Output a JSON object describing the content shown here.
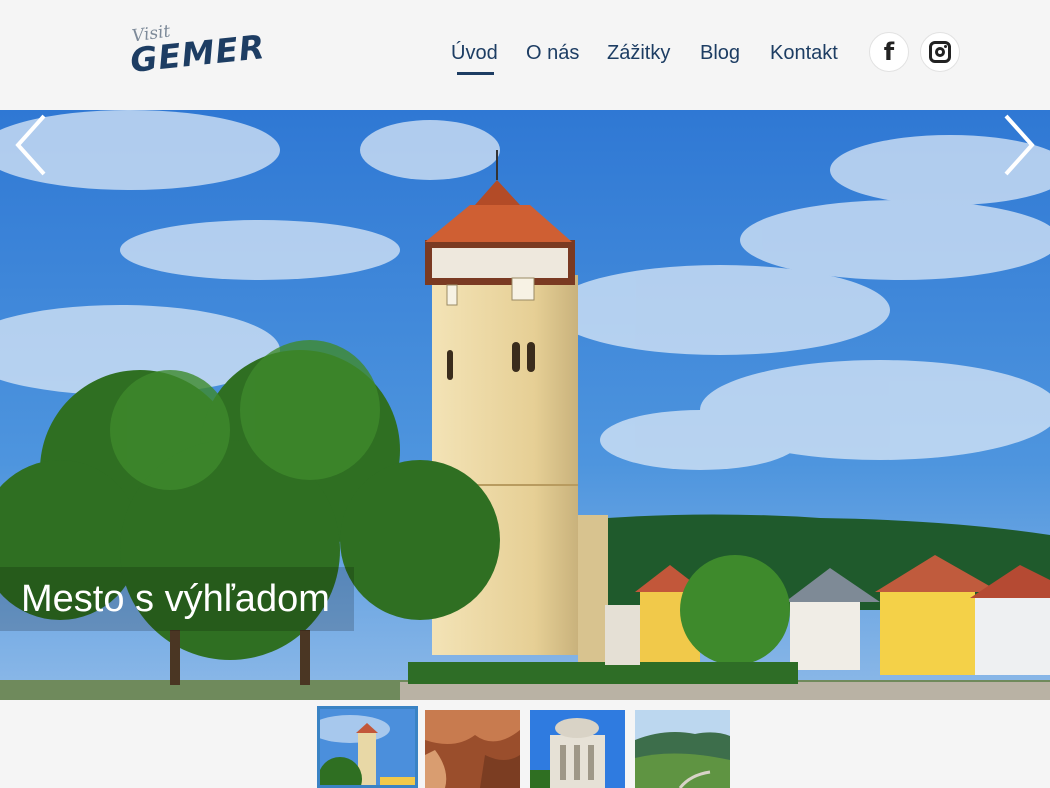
{
  "logo": {
    "small": "Visit",
    "big": "GEMER"
  },
  "nav": {
    "items": [
      {
        "label": "Úvod",
        "active": true
      },
      {
        "label": "O nás",
        "active": false
      },
      {
        "label": "Zážitky",
        "active": false
      },
      {
        "label": "Blog",
        "active": false
      },
      {
        "label": "Kontakt",
        "active": false
      }
    ]
  },
  "social": {
    "facebook": "facebook-icon",
    "instagram": "instagram-icon"
  },
  "slider": {
    "caption": "Mesto s výhľadom",
    "prev_icon": "chevron-left-icon",
    "next_icon": "chevron-right-icon",
    "active_index": 0,
    "thumbnails": [
      {
        "subject": "tower"
      },
      {
        "subject": "cave"
      },
      {
        "subject": "mausoleum"
      },
      {
        "subject": "hills"
      }
    ]
  },
  "colors": {
    "brand": "#1d3d63",
    "accent": "#3a83c4",
    "sky": "#3f86d8"
  }
}
